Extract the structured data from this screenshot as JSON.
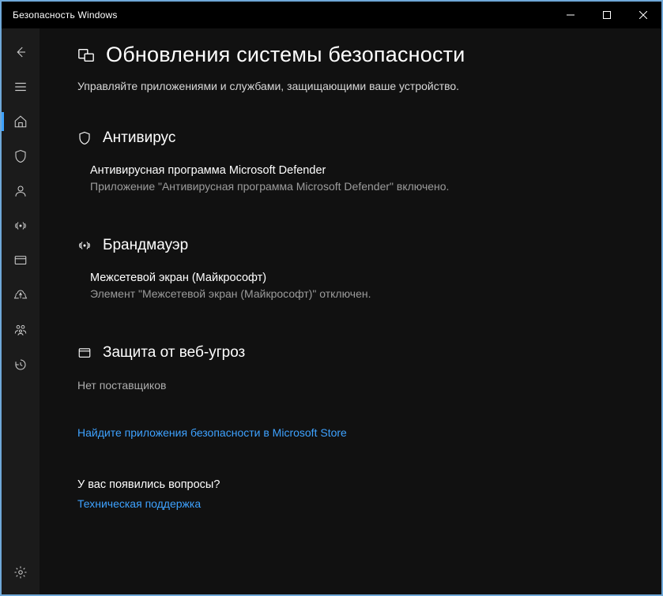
{
  "titlebar": {
    "title": "Безопасность Windows"
  },
  "sidebar": {
    "back": "back",
    "menu": "menu",
    "items": [
      "home",
      "virus",
      "account",
      "firewall",
      "app",
      "device",
      "family",
      "history"
    ],
    "settings": "settings"
  },
  "page": {
    "title": "Обновления системы безопасности",
    "subtitle": "Управляйте приложениями и службами, защищающими ваше устройство."
  },
  "sections": {
    "antivirus": {
      "title": "Антивирус",
      "item_title": "Антивирусная программа Microsoft Defender",
      "item_desc": "Приложение \"Антивирусная программа Microsoft Defender\" включено."
    },
    "firewall": {
      "title": "Брандмауэр",
      "item_title": "Межсетевой экран (Майкрософт)",
      "item_desc": "Элемент \"Межсетевой экран (Майкрософт)\" отключен."
    },
    "web": {
      "title": "Защита от веб-угроз",
      "no_providers": "Нет поставщиков"
    }
  },
  "store_link": "Найдите приложения безопасности в Microsoft Store",
  "help": {
    "question": "У вас появились вопросы?",
    "support": "Техническая поддержка"
  }
}
